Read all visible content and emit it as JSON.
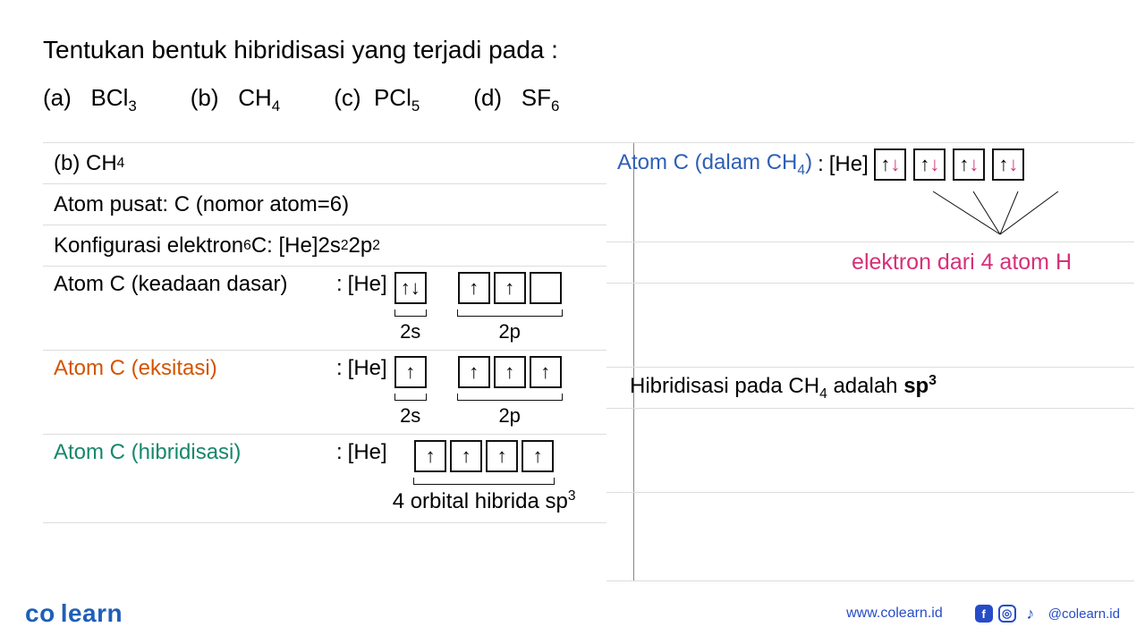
{
  "title": "Tentukan bentuk hibridisasi yang terjadi pada :",
  "options": {
    "a": {
      "label": "(a)",
      "mol": "BCl",
      "sub": "3"
    },
    "b": {
      "label": "(b)",
      "mol": "CH",
      "sub": "4"
    },
    "c": {
      "label": "(c)",
      "mol": "PCl",
      "sub": "5"
    },
    "d": {
      "label": "(d)",
      "mol": "SF",
      "sub": "6"
    }
  },
  "left": {
    "answer_label": "(b) CH",
    "answer_sub": "4",
    "central_atom": "Atom pusat: C (nomor atom=6)",
    "config_label": "Konfigurasi elektron ",
    "config_sub": "6",
    "config_elem": "C: [He]2s",
    "config_s_sup": "2",
    "config_p": "2p",
    "config_p_sup": "2",
    "ground_label": "Atom C (keadaan dasar)",
    "excited_label": "Atom C (eksitasi)",
    "hybrid_label": "Atom C (hibridisasi)",
    "he": "[He]",
    "s_label": "2s",
    "p_label": "2p",
    "hybrid_caption": "4 orbital hibrida sp",
    "hybrid_sup": "3",
    "arrows": {
      "updown": "↑↓",
      "up": "↑",
      "empty": ""
    }
  },
  "right": {
    "bond_label_a": "Atom C (dalam CH",
    "bond_sub": "4",
    "bond_label_b": ")",
    "he": "[He]",
    "pair": "↑",
    "pair_red": "↓",
    "electrons_note": "elektron dari 4 atom H",
    "result_a": "Hibridisasi pada CH",
    "result_sub": "4",
    "result_b": " adalah ",
    "result_c": "sp",
    "result_sup": "3"
  },
  "footer": {
    "brand_a": "co",
    "brand_b": "learn",
    "url": "www.colearn.id",
    "handle": "@colearn.id"
  }
}
